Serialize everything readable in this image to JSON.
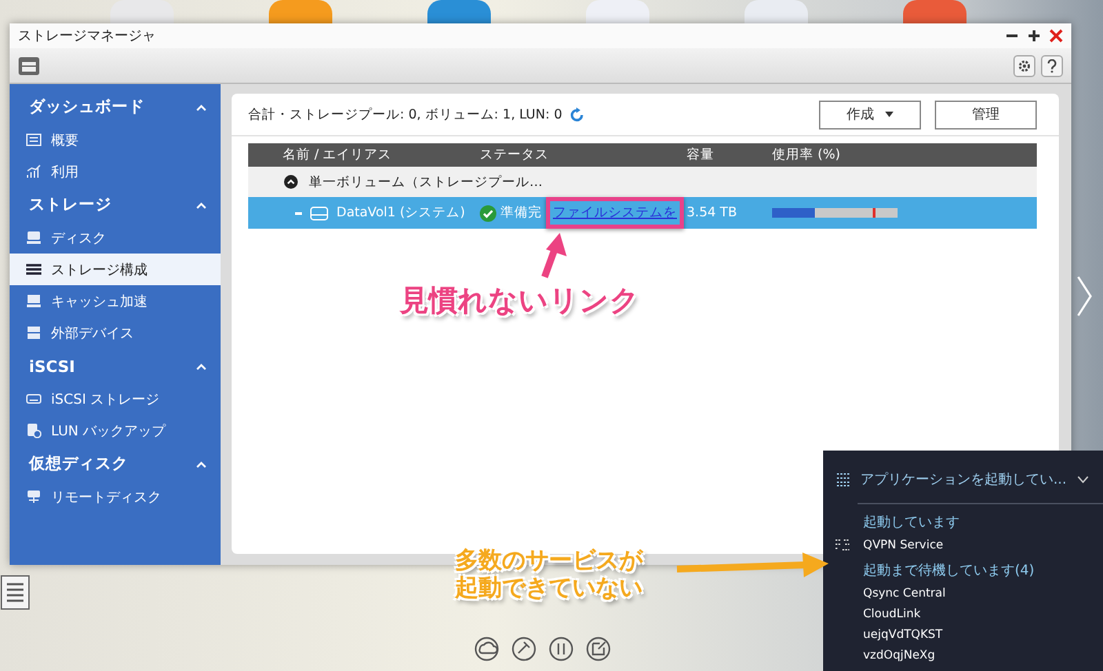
{
  "window": {
    "title": "ストレージマネージャ"
  },
  "sidebar": {
    "sections": [
      {
        "title": "ダッシュボード",
        "expanded": true,
        "items": [
          {
            "label": "概要",
            "selected": false
          },
          {
            "label": "利用",
            "selected": false
          }
        ]
      },
      {
        "title": "ストレージ",
        "expanded": true,
        "items": [
          {
            "label": "ディスク",
            "selected": false
          },
          {
            "label": "ストレージ構成",
            "selected": true
          },
          {
            "label": "キャッシュ加速",
            "selected": false
          },
          {
            "label": "外部デバイス",
            "selected": false
          }
        ]
      },
      {
        "title": "iSCSI",
        "expanded": true,
        "items": [
          {
            "label": "iSCSI ストレージ",
            "selected": false
          },
          {
            "label": "LUN バックアップ",
            "selected": false
          }
        ]
      },
      {
        "title": "仮想ディスク",
        "expanded": true,
        "items": [
          {
            "label": "リモートディスク",
            "selected": false
          }
        ]
      }
    ]
  },
  "content": {
    "summary": "合計・ストレージプール: 0, ボリューム: 1, LUN: 0",
    "buttons": [
      {
        "label": "作成",
        "kind": "dropdown"
      },
      {
        "label": "管理",
        "kind": "plain"
      }
    ],
    "table": {
      "columns": [
        "名前 / エイリアス",
        "ステータス",
        "容量",
        "使用率 (%)"
      ],
      "group": {
        "label": "単一ボリューム（ストレージプール…",
        "expanded": true
      },
      "rows": [
        {
          "name": "DataVol1 (システム)",
          "status": "準備完",
          "link": "ファイルシステムを",
          "capacity": "3.54 TB",
          "usage": {
            "level": 0.34
          },
          "selected": true
        }
      ]
    }
  },
  "notifications": {
    "title": "アプリケーションを起動してい...",
    "expanded": true,
    "sections": [
      {
        "heading": "起動しています",
        "items": [
          "QVPN Service"
        ]
      },
      {
        "heading": "起動まで待機しています(4)",
        "items": [
          "Qsync Central",
          "CloudLink",
          "uejqVdTQKST",
          "vzdOqjNeXg"
        ]
      }
    ]
  },
  "annotations": [
    {
      "text": "見慣れないリンク",
      "color": "#ec4382"
    },
    {
      "text": "多数のサービスが起動できていない",
      "color": "#f5a91e"
    }
  ]
}
